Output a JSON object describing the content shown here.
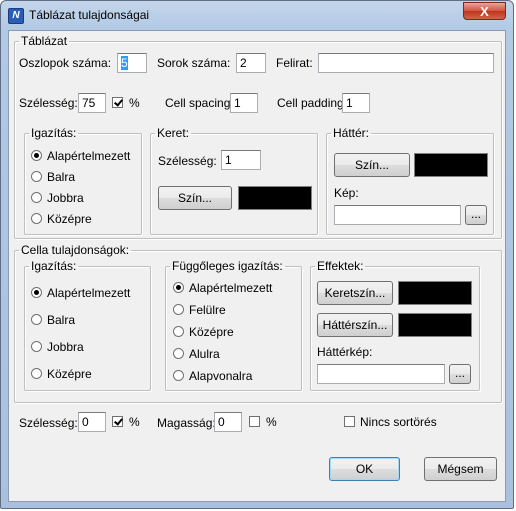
{
  "window": {
    "title": "Táblázat tulajdonságai",
    "close_glyph": "X"
  },
  "table": {
    "group_label": "Táblázat",
    "columns_label": "Oszlopok száma:",
    "columns_value": "5",
    "rows_label": "Sorok száma:",
    "rows_value": "2",
    "caption_label": "Felirat:",
    "caption_value": "",
    "width_label": "Szélesség:",
    "width_value": "75",
    "width_percent": true,
    "percent_label": "%",
    "cell_spacing_label": "Cell spacing:",
    "cell_spacing_value": "1",
    "cell_padding_label": "Cell padding:",
    "cell_padding_value": "1",
    "align": {
      "label": "Igazítás:",
      "options": [
        "Alapértelmezett",
        "Balra",
        "Jobbra",
        "Középre"
      ],
      "selected": 0
    },
    "border": {
      "label": "Keret:",
      "width_label": "Szélesség:",
      "width_value": "1",
      "color_button": "Szín...",
      "color": "#000000"
    },
    "background": {
      "label": "Háttér:",
      "color_button": "Szín...",
      "color": "#000000",
      "image_label": "Kép:",
      "image_value": "",
      "browse": "..."
    }
  },
  "cell": {
    "group_label": "Cella tulajdonságok:",
    "align": {
      "label": "Igazítás:",
      "options": [
        "Alapértelmezett",
        "Balra",
        "Jobbra",
        "Középre"
      ],
      "selected": 0
    },
    "valign": {
      "label": "Függőleges igazítás:",
      "options": [
        "Alapértelmezett",
        "Felülre",
        "Középre",
        "Alulra",
        "Alapvonalra"
      ],
      "selected": 0
    },
    "effects": {
      "label": "Effektek:",
      "border_color_button": "Keretszín...",
      "border_color": "#000000",
      "bg_color_button": "Háttérszín...",
      "bg_color": "#000000",
      "bg_image_label": "Háttérkép:",
      "bg_image_value": "",
      "browse": "..."
    },
    "width_label": "Szélesség:",
    "width_value": "0",
    "width_percent": true,
    "height_label": "Magasság:",
    "height_value": "0",
    "height_percent": false,
    "percent_label": "%",
    "nowrap_label": "Nincs sortörés",
    "nowrap": false
  },
  "buttons": {
    "ok": "OK",
    "cancel": "Mégsem"
  }
}
